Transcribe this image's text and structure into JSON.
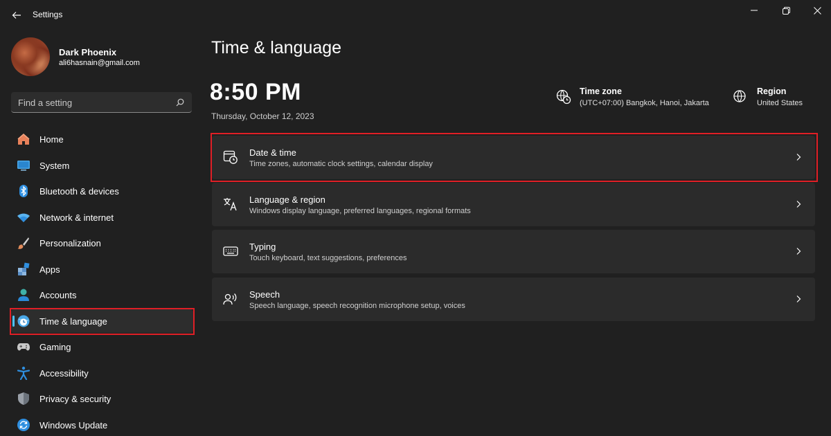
{
  "window": {
    "title": "Settings",
    "back_icon": "back-arrow-icon",
    "controls": [
      "minimize-icon",
      "restore-icon",
      "close-icon"
    ]
  },
  "profile": {
    "name": "Dark Phoenix",
    "email": "ali6hasnain@gmail.com"
  },
  "search": {
    "placeholder": "Find a setting",
    "icon": "search-icon"
  },
  "sidebar": {
    "items": [
      {
        "label": "Home",
        "icon": "home-icon",
        "color": "#e8815a"
      },
      {
        "label": "System",
        "icon": "system-icon",
        "color": "#4aa8e8"
      },
      {
        "label": "Bluetooth & devices",
        "icon": "bluetooth-icon",
        "color": "#2f8fe0"
      },
      {
        "label": "Network & internet",
        "icon": "wifi-icon",
        "color": "#5ab4f0"
      },
      {
        "label": "Personalization",
        "icon": "brush-icon",
        "color": "#e08a5a"
      },
      {
        "label": "Apps",
        "icon": "apps-icon",
        "color": "#8fb8e0"
      },
      {
        "label": "Accounts",
        "icon": "accounts-icon",
        "color": "#3fb0a8"
      },
      {
        "label": "Time & language",
        "icon": "time-language-icon",
        "color": "#4aa8e8",
        "active": true
      },
      {
        "label": "Gaming",
        "icon": "gaming-icon",
        "color": "#b0b0b0"
      },
      {
        "label": "Accessibility",
        "icon": "accessibility-icon",
        "color": "#2f8fe0"
      },
      {
        "label": "Privacy & security",
        "icon": "shield-icon",
        "color": "#9aa0a8"
      },
      {
        "label": "Windows Update",
        "icon": "update-icon",
        "color": "#2f8fe0"
      }
    ]
  },
  "main": {
    "title": "Time & language",
    "time": "8:50 PM",
    "date": "Thursday, October 12, 2023",
    "time_zone": {
      "label": "Time zone",
      "value": "(UTC+07:00) Bangkok, Hanoi, Jakarta",
      "icon": "time-zone-icon"
    },
    "region": {
      "label": "Region",
      "value": "United States",
      "icon": "globe-icon"
    },
    "cards": [
      {
        "title": "Date & time",
        "desc": "Time zones, automatic clock settings, calendar display",
        "icon": "calendar-clock-icon",
        "highlighted": true
      },
      {
        "title": "Language & region",
        "desc": "Windows display language, preferred languages, regional formats",
        "icon": "language-icon"
      },
      {
        "title": "Typing",
        "desc": "Touch keyboard, text suggestions, preferences",
        "icon": "keyboard-icon"
      },
      {
        "title": "Speech",
        "desc": "Speech language, speech recognition microphone setup, voices",
        "icon": "speech-icon"
      }
    ]
  },
  "colors": {
    "background": "#202020",
    "card": "#2b2b2b",
    "accent": "#4cc2ff",
    "highlight_border": "#e01f26"
  }
}
